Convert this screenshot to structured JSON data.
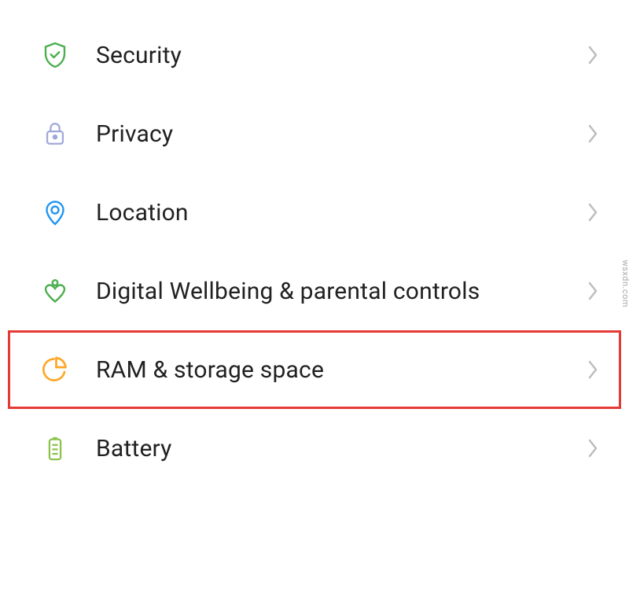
{
  "settings": {
    "items": [
      {
        "id": "security",
        "label": "Security",
        "icon": "shield-check",
        "iconColor": "#4caf50",
        "highlighted": false
      },
      {
        "id": "privacy",
        "label": "Privacy",
        "icon": "lock",
        "iconColor": "#9fa8da",
        "highlighted": false
      },
      {
        "id": "location",
        "label": "Location",
        "icon": "location-pin",
        "iconColor": "#2196f3",
        "highlighted": false
      },
      {
        "id": "wellbeing",
        "label": "Digital Wellbeing & parental controls",
        "icon": "wellbeing-heart",
        "iconColor": "#4caf50",
        "highlighted": false
      },
      {
        "id": "storage",
        "label": "RAM & storage space",
        "icon": "pie-chart",
        "iconColor": "#ffa726",
        "highlighted": true
      },
      {
        "id": "battery",
        "label": "Battery",
        "icon": "battery",
        "iconColor": "#8bc34a",
        "highlighted": false
      }
    ]
  },
  "chevronColor": "#bdbdbd",
  "watermark": "wsxdn.com"
}
